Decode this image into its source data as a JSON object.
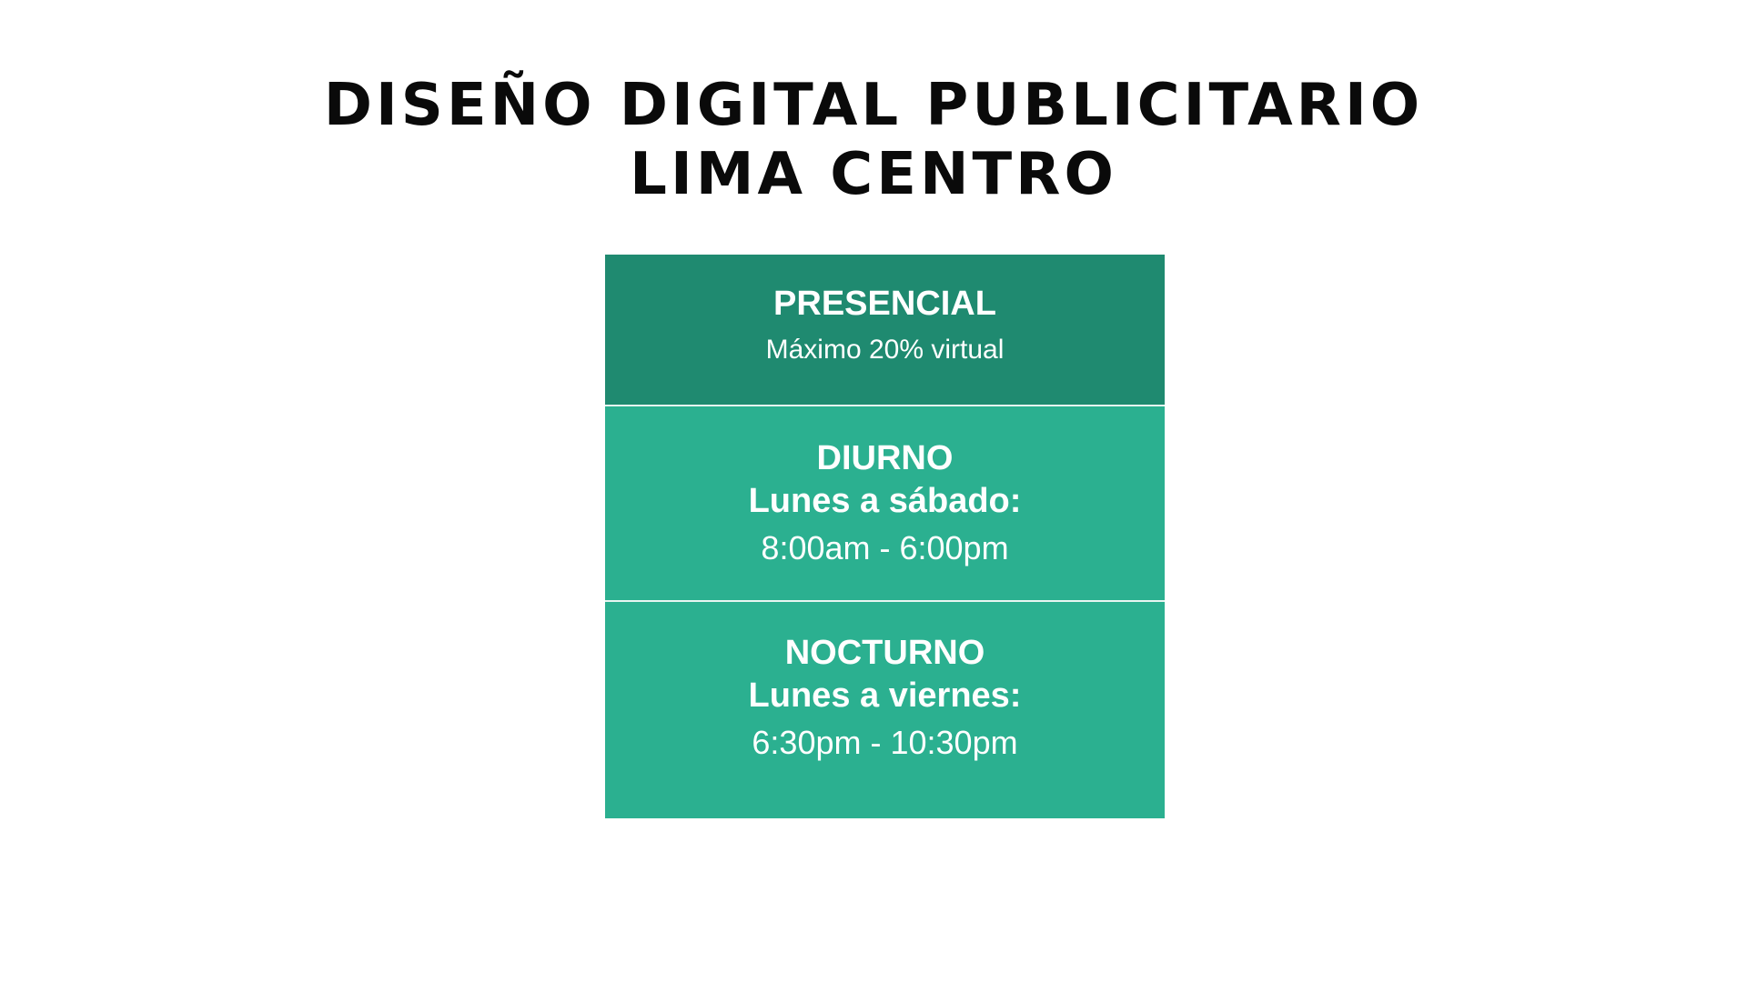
{
  "title": {
    "line1": "DISEÑO DIGITAL PUBLICITARIO",
    "line2": "LIMA CENTRO"
  },
  "modality": {
    "label": "PRESENCIAL",
    "note": "Máximo 20% virtual"
  },
  "schedules": [
    {
      "shift": "DIURNO",
      "days": "Lunes a sábado:",
      "hours": "8:00am - 6:00pm"
    },
    {
      "shift": "NOCTURNO",
      "days": "Lunes a viernes:",
      "hours": "6:30pm - 10:30pm"
    }
  ],
  "colors": {
    "modality_bg": "#1f8a70",
    "schedule_bg": "#2bb090",
    "divider": "#e7f6f1",
    "title_text": "#0a0a0a"
  }
}
